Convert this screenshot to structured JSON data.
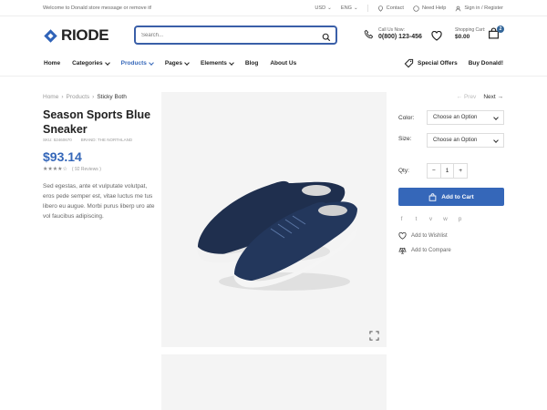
{
  "topbar": {
    "welcome": "Welcome to Donald store message or remove it!",
    "currency": "USD",
    "language": "ENG",
    "contact": "Contact",
    "help": "Need Help",
    "signin": "Sign in / Register"
  },
  "header": {
    "logo": "RIODE",
    "search_placeholder": "Search...",
    "call_label": "Call Us Now:",
    "phone": "0(800) 123-456",
    "cart_label": "Shopping Cart:",
    "cart_total": "$0.00",
    "cart_count": "2"
  },
  "nav": {
    "items": [
      {
        "label": "Home"
      },
      {
        "label": "Categories"
      },
      {
        "label": "Products"
      },
      {
        "label": "Pages"
      },
      {
        "label": "Elements"
      },
      {
        "label": "Blog"
      },
      {
        "label": "About Us"
      }
    ],
    "special_offers": "Special Offers",
    "buy": "Buy Donald!",
    "accent": "#3567b9"
  },
  "product": {
    "breadcrumb": [
      "Home",
      "Products",
      "Sticky Both"
    ],
    "title": "Season Sports Blue Sneaker",
    "sku": "SKU: 52460670",
    "brand": "BRAND: THE NORTHLAND",
    "price": "$93.14",
    "rating_stars": 4,
    "reviews": "( 92 Reviews )",
    "description": "Sed egestas, ante et vulputate volutpat, eros pede semper est, vitae luctus me tus libero eu augue. Morbi purus liberp uro ate vol faucibus adipiscing."
  },
  "options": {
    "prev": "Prev",
    "next": "Next",
    "color_label": "Color:",
    "color_value": "Choose an Option",
    "size_label": "Size:",
    "size_value": "Choose an Option",
    "qty_label": "Qty:",
    "qty_minus": "−",
    "qty_value": "1",
    "qty_plus": "+",
    "add_to_cart": "Add to Cart",
    "social": [
      "f",
      "t",
      "v",
      "w",
      "p"
    ],
    "wishlist": "Add to Wishlist",
    "compare": "Add to Compare"
  }
}
